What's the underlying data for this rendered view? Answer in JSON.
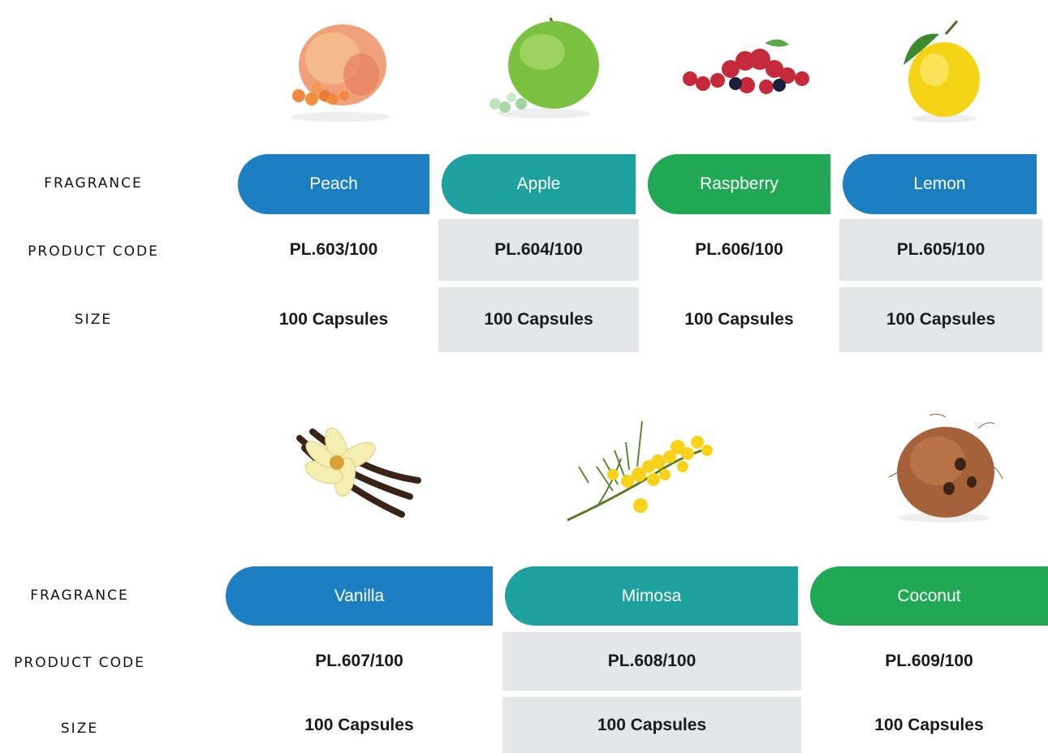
{
  "labels": {
    "fragrance": "FRAGRANCE",
    "product_code": "PRODUCT CODE",
    "size": "SIZE"
  },
  "colors": {
    "blue": "#1b7fc2",
    "teal": "#1ea19e",
    "green": "#20a854",
    "grey_cell": "#e5e6e8"
  },
  "products": [
    {
      "fragrance": "Peach",
      "code": "PL.603/100",
      "size": "100 Capsules",
      "icon": "peach-image"
    },
    {
      "fragrance": "Apple",
      "code": "PL.604/100",
      "size": "100 Capsules",
      "icon": "apple-image"
    },
    {
      "fragrance": "Raspberry",
      "code": "PL.606/100",
      "size": "100 Capsules",
      "icon": "raspberry-image"
    },
    {
      "fragrance": "Lemon",
      "code": "PL.605/100",
      "size": "100 Capsules",
      "icon": "lemon-image"
    },
    {
      "fragrance": "Vanilla",
      "code": "PL.607/100",
      "size": "100 Capsules",
      "icon": "vanilla-image"
    },
    {
      "fragrance": "Mimosa",
      "code": "PL.608/100",
      "size": "100 Capsules",
      "icon": "mimosa-image"
    },
    {
      "fragrance": "Coconut",
      "code": "PL.609/100",
      "size": "100 Capsules",
      "icon": "coconut-image"
    }
  ]
}
